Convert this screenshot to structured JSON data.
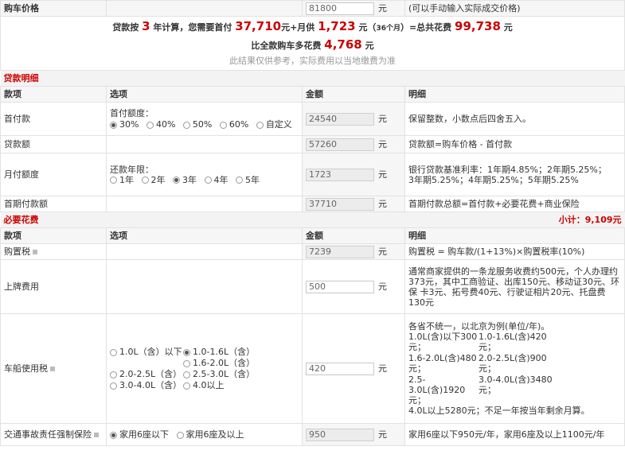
{
  "top": {
    "car_price_label": "购车价格",
    "car_price_value": "81800",
    "unit": "元",
    "car_price_hint": "(可以手动输入实际成交价格)"
  },
  "summary": {
    "t1": "贷款按",
    "years": "3",
    "t2": "年计算，您需要首付",
    "down_payment": "37,710",
    "t3": "元+月供",
    "monthly": "1,723",
    "t4": "元（",
    "months": "36个月",
    "t5": "）=总共花费",
    "total": "99,738",
    "t6": "元",
    "more_t1": "比全款购车多花费",
    "more_value": "4,768",
    "more_t2": "元",
    "note": "此结果仅供参考，实际费用以当地缴费为准"
  },
  "loan_section": {
    "title": "贷款明细",
    "headers": [
      "款项",
      "选项",
      "金额",
      "明细"
    ],
    "down": {
      "label": "首付款",
      "option_title": "首付额度：",
      "options": [
        "30%",
        "40%",
        "50%",
        "60%",
        "自定义"
      ],
      "value": "24540",
      "detail": "保留整数，小数点后四舍五入。"
    },
    "loan": {
      "label": "贷款额",
      "value": "57260",
      "detail": "贷款额=购车价格 - 首付款"
    },
    "monthly": {
      "label": "月付额度",
      "option_title": "还款年限：",
      "options": [
        "1年",
        "2年",
        "3年",
        "4年",
        "5年"
      ],
      "value": "1723",
      "detail_l1": "银行贷款基准利率：1年期4.85%；2年期5.25%；",
      "detail_l2": "3年期5.25%；4年期5.25%；5年期5.25%"
    },
    "first": {
      "label": "首期付款额",
      "value": "37710",
      "detail": "首期付款总额=首付款+必要花费+商业保险"
    }
  },
  "required_section": {
    "title": "必要花费",
    "subtotal": "小计：9,109元",
    "headers": [
      "款项",
      "选项",
      "金额",
      "明细"
    ],
    "tax": {
      "label": "购置税",
      "value": "7239",
      "detail": "购置税 = 购车款/(1+13%)×购置税率(10%)"
    },
    "plate": {
      "label": "上牌费用",
      "value": "500",
      "detail": "通常商家提供的一条龙服务收费约500元，个人办理约 373元，其中工商验证、出库150元、移动证30元、环保 卡3元、拓号费40元、行驶证相片20元、托盘费130元"
    },
    "vehicle_tax": {
      "label": "车船使用税",
      "options": [
        "1.0L（含）以下",
        "1.0-1.6L（含）",
        "2.0-2.5L（含）",
        "1.6-2.0L（含）",
        "3.0-4.0L（含）",
        "2.5-3.0L（含）",
        "4.0以上"
      ],
      "value": "420",
      "detail_intro": "各省不统一，以北京为例(单位/年)。",
      "detail_items": [
        "1.0L(含)以下300元；",
        "1.0-1.6L(含)420元；",
        "1.6-2.0L(含)480元；",
        "2.0-2.5L(含)900元；",
        "2.5-3.0L(含)1920元；",
        "3.0-4.0L(含)3480元；"
      ],
      "detail_tail": "4.0L以上5280元；不足一年按当年剩余月算。"
    },
    "insurance": {
      "label": "交通事故责任强制保险",
      "options": [
        "家用6座以下",
        "家用6座及以上"
      ],
      "value": "950",
      "detail": "家用6座以下950元/年，家用6座及以上1100元/年"
    }
  }
}
